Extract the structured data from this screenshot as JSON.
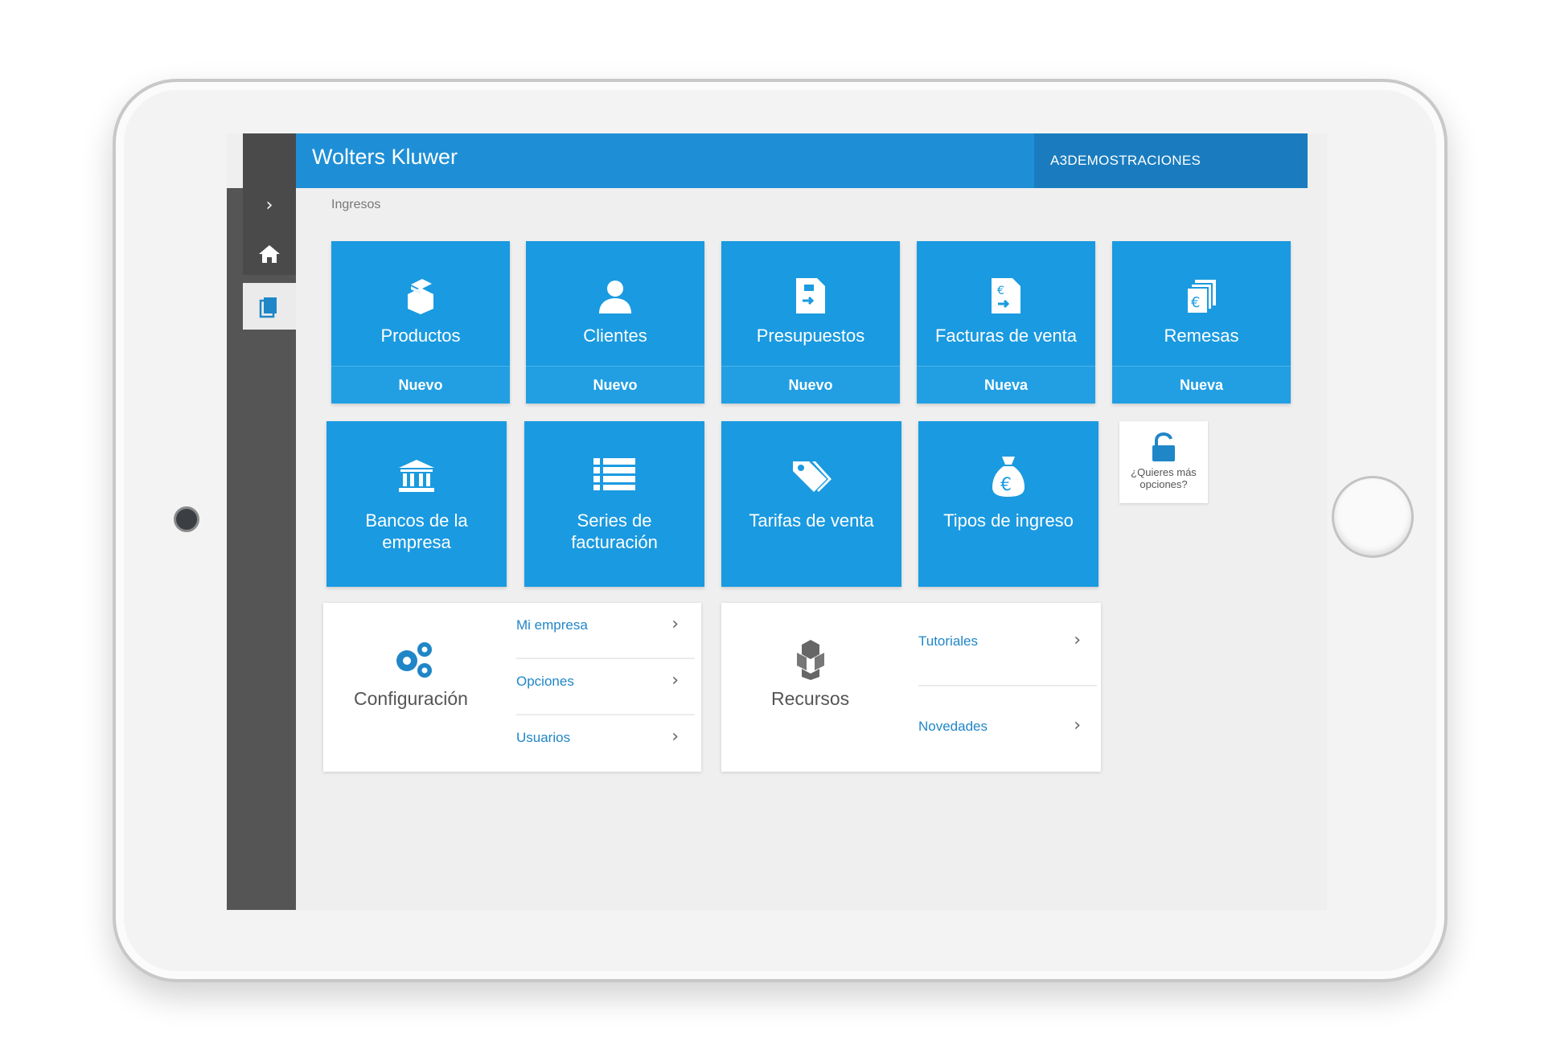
{
  "header": {
    "brand": "Wolters Kluwer",
    "user": "A3DEMOSTRACIONES"
  },
  "sidebar": {
    "items": [
      {
        "icon": "chevron-right-icon"
      },
      {
        "icon": "home-icon"
      },
      {
        "icon": "documents-icon"
      }
    ]
  },
  "breadcrumb": "Ingresos",
  "tiles_row1": [
    {
      "label": "Productos",
      "action": "Nuevo",
      "icon": "boxes-icon"
    },
    {
      "label": "Clientes",
      "action": "Nuevo",
      "icon": "person-icon"
    },
    {
      "label": "Presupuestos",
      "action": "Nuevo",
      "icon": "quote-document-icon"
    },
    {
      "label": "Facturas de venta",
      "action": "Nueva",
      "icon": "invoice-document-icon"
    },
    {
      "label": "Remesas",
      "action": "Nueva",
      "icon": "euro-stack-icon"
    }
  ],
  "tiles_row2": [
    {
      "label": "Bancos de la empresa",
      "icon": "bank-icon"
    },
    {
      "label": "Series de facturación",
      "icon": "list-icon"
    },
    {
      "label": "Tarifas de venta",
      "icon": "tags-icon"
    },
    {
      "label": "Tipos de ingreso",
      "icon": "money-bag-icon"
    }
  ],
  "more_options": {
    "label": "¿Quieres más opciones?",
    "icon": "unlock-icon"
  },
  "config_card": {
    "title": "Configuración",
    "links": [
      "Mi empresa",
      "Opciones",
      "Usuarios"
    ]
  },
  "resources_card": {
    "title": "Recursos",
    "links": [
      "Tutoriales",
      "Novedades"
    ]
  },
  "colors": {
    "accent": "#1e8fd6",
    "tile": "#1a9ae0",
    "sidebar": "#555555"
  }
}
